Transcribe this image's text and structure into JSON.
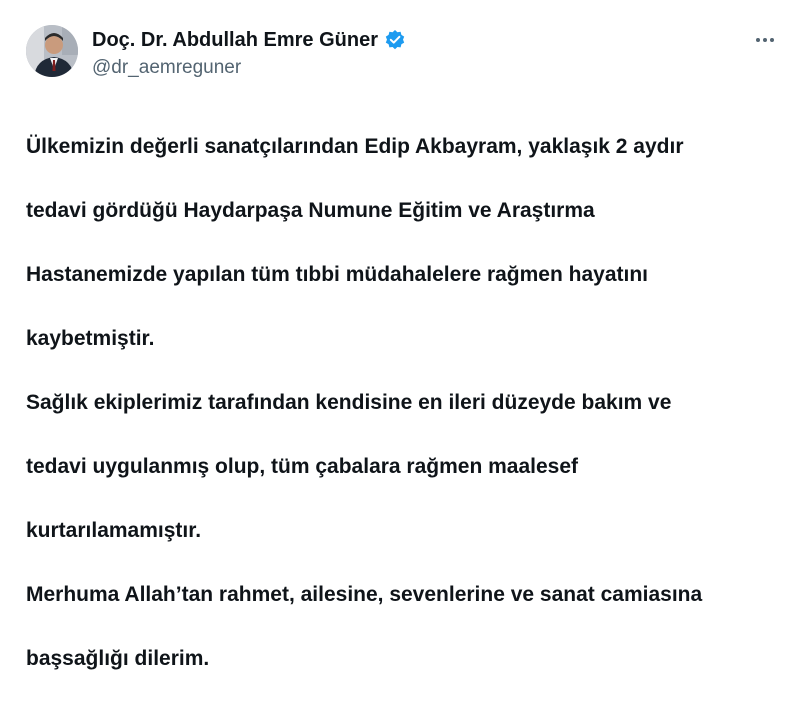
{
  "post": {
    "author": {
      "name": "Doç. Dr. Abdullah Emre Güner",
      "handle": "@dr_aemreguner",
      "verified_icon": "verified-badge-icon",
      "verified_color": "#1d9bf0"
    },
    "more_icon": "more-options-icon",
    "lines": [
      "Ülkemizin değerli sanatçılarından Edip Akbayram, yaklaşık 2 aydır",
      "tedavi gördüğü Haydarpaşa Numune Eğitim ve Araştırma",
      "Hastanemizde yapılan tüm tıbbi müdahalelere rağmen hayatını",
      "kaybetmiştir.",
      "Sağlık ekiplerimiz tarafından kendisine en ileri düzeyde bakım ve",
      "tedavi uygulanmış olup, tüm çabalara rağmen maalesef",
      "kurtarılamamıştır.",
      "Merhuma Allah’tan rahmet, ailesine, sevenlerine ve sanat camiasına",
      "başsağlığı dilerim."
    ]
  }
}
